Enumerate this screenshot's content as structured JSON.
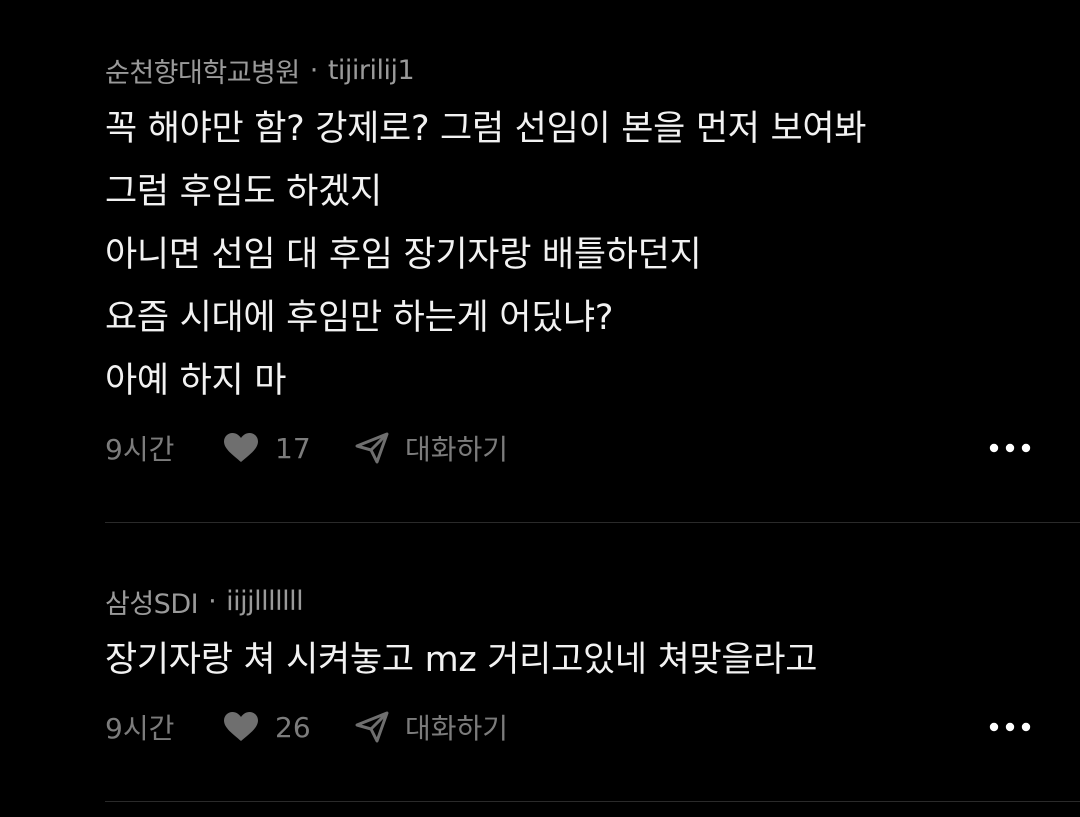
{
  "comments": [
    {
      "author": "순천향대학교병원",
      "separator": "·",
      "username": "tijirilij1",
      "lines": [
        "꼭 해야만 함? 강제로? 그럼 선임이 본을 먼저 보여봐",
        "그럼 후임도 하겠지",
        "아니면 선임 대 후임 장기자랑 배틀하던지",
        "요즘 시대에 후임만 하는게 어딨냐?",
        "아예 하지 마"
      ],
      "time": "9시간",
      "likes": "17",
      "reply_label": "대화하기"
    },
    {
      "author": "삼성SDI",
      "separator": "·",
      "username": "iijjlllllll",
      "lines": [
        "장기자랑 쳐 시켜놓고 mz 거리고있네 쳐맞을라고"
      ],
      "time": "9시간",
      "likes": "26",
      "reply_label": "대화하기"
    }
  ],
  "icons": {
    "like": "heart-icon",
    "reply": "send-icon",
    "more": "more-horizontal-icon"
  },
  "colors": {
    "background": "#000000",
    "text": "#f2f2f2",
    "meta": "#9a9a9a",
    "muted": "#7c7c7c"
  }
}
